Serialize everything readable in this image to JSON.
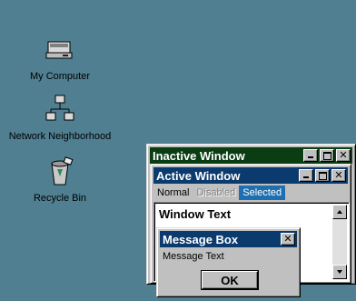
{
  "desktop": {
    "icons": [
      {
        "label": "My Computer",
        "icon": "computer-icon"
      },
      {
        "label": "Network Neighborhood",
        "icon": "network-icon"
      },
      {
        "label": "Recycle Bin",
        "icon": "recycle-bin-icon"
      }
    ],
    "background": "#4f7f90"
  },
  "inactive_window": {
    "title": "Inactive Window",
    "title_color": "#0b3d12",
    "buttons": {
      "minimize": "_",
      "maximize": "□",
      "close": "✕"
    }
  },
  "active_window": {
    "title": "Active Window",
    "title_color": "#0b3b6e",
    "menu": {
      "normal": "Normal",
      "disabled": "Disabled",
      "selected": "Selected"
    },
    "window_text": "Window Text"
  },
  "message_box": {
    "title": "Message Box",
    "text": "Message Text",
    "ok_label": "OK"
  }
}
